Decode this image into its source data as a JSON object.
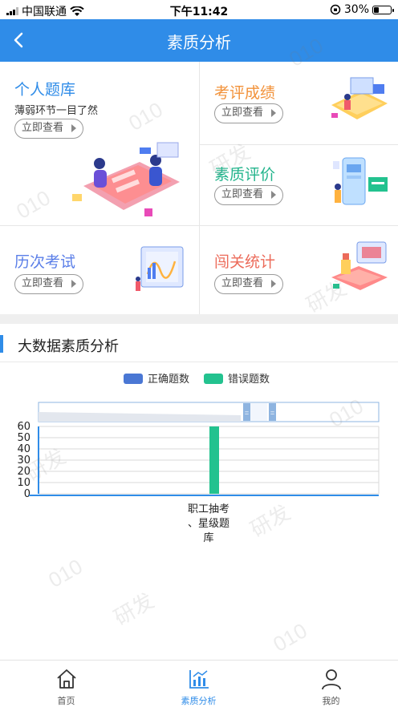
{
  "status_bar": {
    "carrier": "中国联通",
    "time": "下午11:42",
    "battery": "30%",
    "battery_level": 0.3
  },
  "nav": {
    "title": "素质分析"
  },
  "cards": {
    "personal": {
      "title": "个人题库",
      "subtitle": "薄弱环节一目了然",
      "btn": "立即查看",
      "color": "#2f8ce8"
    },
    "exam_score": {
      "title": "考评成绩",
      "btn": "立即查看",
      "color": "#f2923a"
    },
    "quality_eval": {
      "title": "素质评价",
      "btn": "立即查看",
      "color": "#23b48c"
    },
    "history_exam": {
      "title": "历次考试",
      "btn": "立即查看",
      "color": "#5b7fe8"
    },
    "level_stats": {
      "title": "闯关统计",
      "btn": "立即查看",
      "color": "#ec6b5a"
    }
  },
  "section": {
    "title": "大数据素质分析"
  },
  "chart_data": {
    "type": "bar",
    "categories": [
      "职工抽考、星级题库"
    ],
    "series": [
      {
        "name": "正确题数",
        "values": [
          0
        ],
        "color": "#4a77d4"
      },
      {
        "name": "错误题数",
        "values": [
          60
        ],
        "color": "#23c28f"
      }
    ],
    "yticks": [
      "60",
      "50",
      "40",
      "30",
      "20",
      "10",
      "0"
    ],
    "ylim": [
      0,
      60
    ],
    "category_label_lines": [
      "职工抽考",
      "、星级题",
      "库"
    ],
    "legend_position": "top-center"
  },
  "tabbar": {
    "items": [
      {
        "label": "首页",
        "icon": "home-icon"
      },
      {
        "label": "素质分析",
        "icon": "chart-icon"
      },
      {
        "label": "我的",
        "icon": "user-icon"
      }
    ]
  },
  "colors": {
    "accent": "#2f8ce8"
  }
}
